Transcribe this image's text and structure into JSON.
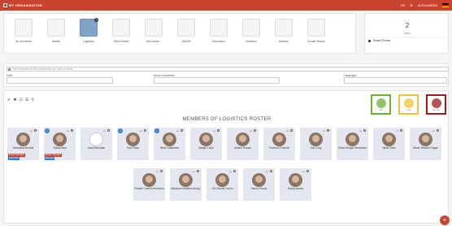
{
  "topbar": {
    "title": "MY ORGANISATION",
    "lang": "DE",
    "user": "ALEXANDRA"
  },
  "tiles": [
    {
      "label": "All members",
      "icon": "members-icon",
      "active": false
    },
    {
      "label": "Health",
      "icon": "filter-icon",
      "active": false
    },
    {
      "label": "Logistics",
      "icon": "logistics-icon",
      "active": true
    },
    {
      "label": "Third Roster",
      "icon": "fox-icon",
      "active": false
    },
    {
      "label": "Test roster -",
      "icon": "first-aid-icon",
      "active": false
    },
    {
      "label": "WASH",
      "icon": "wash-icon",
      "active": false
    },
    {
      "label": "Education",
      "icon": "shield-icon",
      "active": false
    },
    {
      "label": "Nutrition",
      "icon": "nutrition-icon",
      "active": false
    },
    {
      "label": "Another",
      "icon": "magnet-icon",
      "active": false
    },
    {
      "label": "Create Roster",
      "icon": "plus-icon",
      "active": false
    }
  ],
  "stats": {
    "count": "2",
    "label": "alerts",
    "row": "Roster Events"
  },
  "filter": {
    "search_placeholder": "Filter members of this organisation by name or email",
    "skills_label": "Skills",
    "expertise_label": "Areas of expertise",
    "languages_label": "Languages"
  },
  "roster": {
    "title": "MEMBERS OF LOGISTICS ROSTER",
    "actions": [
      {
        "label": "Add",
        "color": "#6cae3a"
      },
      {
        "label": "Invite",
        "color": "#f1c232"
      },
      {
        "label": "Remove",
        "color": "#9e1b1b"
      }
    ],
    "members": [
      {
        "name": "Alexandra Burnett",
        "check": false,
        "tags": [
          {
            "text": "Roster Manager",
            "color": "#c8442e"
          },
          {
            "text": "Supervisor",
            "color": "#2f7fd1"
          }
        ]
      },
      {
        "name": "Tobias Blau",
        "check": true,
        "tags": [
          {
            "text": "Roster Manager",
            "color": "#c8442e"
          },
          {
            "text": "Manager",
            "color": "#2f7fd1"
          }
        ]
      },
      {
        "name": "Jana Neumann",
        "check": false,
        "empty": true,
        "tags": []
      },
      {
        "name": "Tina Prado",
        "check": true,
        "tags": []
      },
      {
        "name": "Silvia Valladares",
        "check": true,
        "tags": []
      },
      {
        "name": "Marjan Lukić",
        "check": false,
        "tags": []
      },
      {
        "name": "Juliane Krause",
        "check": false,
        "tags": []
      },
      {
        "name": "Florence Fullcroft",
        "check": false,
        "tags": []
      },
      {
        "name": "Sun Fong",
        "check": false,
        "tags": []
      },
      {
        "name": "Olivia Ortega Hernandez",
        "check": false,
        "tags": []
      },
      {
        "name": "Djello Okito",
        "check": false,
        "tags": []
      },
      {
        "name": "Nimer Shweka Pagan",
        "check": false,
        "tags": []
      },
      {
        "name": "Renato Cozono Moncalía",
        "check": false,
        "tags": []
      },
      {
        "name": "Abraham Martinez Araujo",
        "check": false,
        "tags": []
      },
      {
        "name": "Ciro Rocha Cunha",
        "check": false,
        "tags": []
      },
      {
        "name": "Siseno Sousa",
        "check": false,
        "tags": []
      },
      {
        "name": "Bobby Award",
        "check": false,
        "tags": []
      }
    ]
  }
}
